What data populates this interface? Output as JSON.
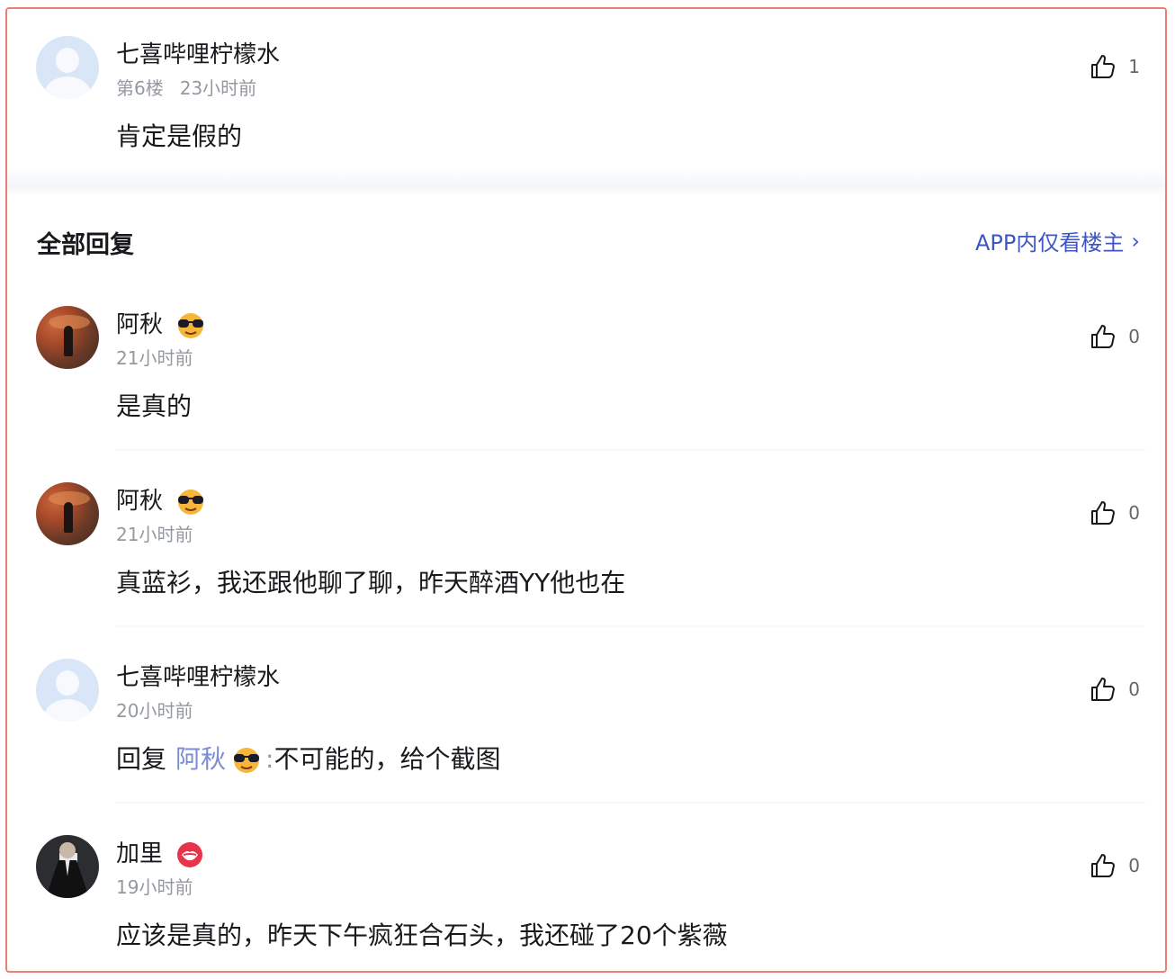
{
  "main_comment": {
    "user": "七喜哔哩柠檬水",
    "floor": "第6楼",
    "time": "23小时前",
    "text": "肯定是假的",
    "likes": "1"
  },
  "section": {
    "title": "全部回复",
    "host_link": "APP内仅看楼主"
  },
  "replies": [
    {
      "user": "阿秋",
      "badge_icon": "sunglasses-emoji",
      "time": "21小时前",
      "text": "是真的",
      "likes": "0"
    },
    {
      "user": "阿秋",
      "badge_icon": "sunglasses-emoji",
      "time": "21小时前",
      "text": "真蓝衫，我还跟他聊了聊，昨天醉酒YY他也在",
      "likes": "0"
    },
    {
      "user": "七喜哔哩柠檬水",
      "time": "20小时前",
      "reply_prefix": "回复",
      "mention": "阿秋",
      "mention_icon": "sunglasses-emoji",
      "colon": ":",
      "text": "不可能的，给个截图",
      "likes": "0"
    },
    {
      "user": "加里",
      "badge_icon": "lips-emoji",
      "time": "19小时前",
      "text": "应该是真的，昨天下午疯狂合石头，我还碰了20个紫薇",
      "likes": "0"
    }
  ],
  "icons": {
    "like": "thumbs-up-icon",
    "chevron": "chevron-right-icon"
  },
  "colors": {
    "link": "#3e55c6",
    "mention": "#7c8bd6",
    "meta": "#9499a0",
    "frame_border": "#ef7b7b"
  }
}
